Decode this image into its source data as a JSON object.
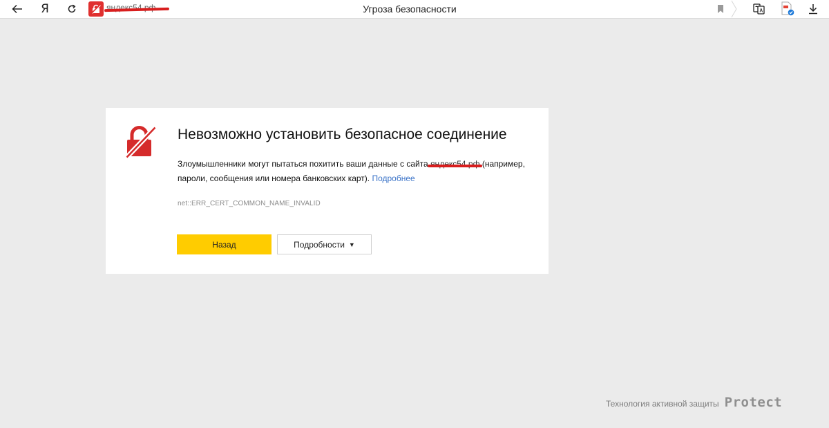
{
  "browser": {
    "ya_label": "Я",
    "domain": "яндекс54.рф",
    "tab_title": "Угроза безопасности"
  },
  "warning": {
    "title": "Невозможно установить безопасное соединение",
    "desc_before": "Злоумышленники могут пытаться похитить ваши данные с сайта ",
    "site": "яндекс54.рф",
    "desc_after": " (например, пароли, сообщения или номера банковских карт). ",
    "more_link": "Подробнее",
    "error_code": "net::ERR_CERT_COMMON_NAME_INVALID",
    "back_button": "Назад",
    "details_button": "Подробности",
    "details_caret": "▼"
  },
  "footer": {
    "text": "Технология активной защиты",
    "brand": "Protect"
  },
  "colors": {
    "accent_yellow": "#ffcc00",
    "danger_red": "#d52b2b",
    "link_blue": "#3c74c8",
    "page_bg": "#ebebeb"
  }
}
